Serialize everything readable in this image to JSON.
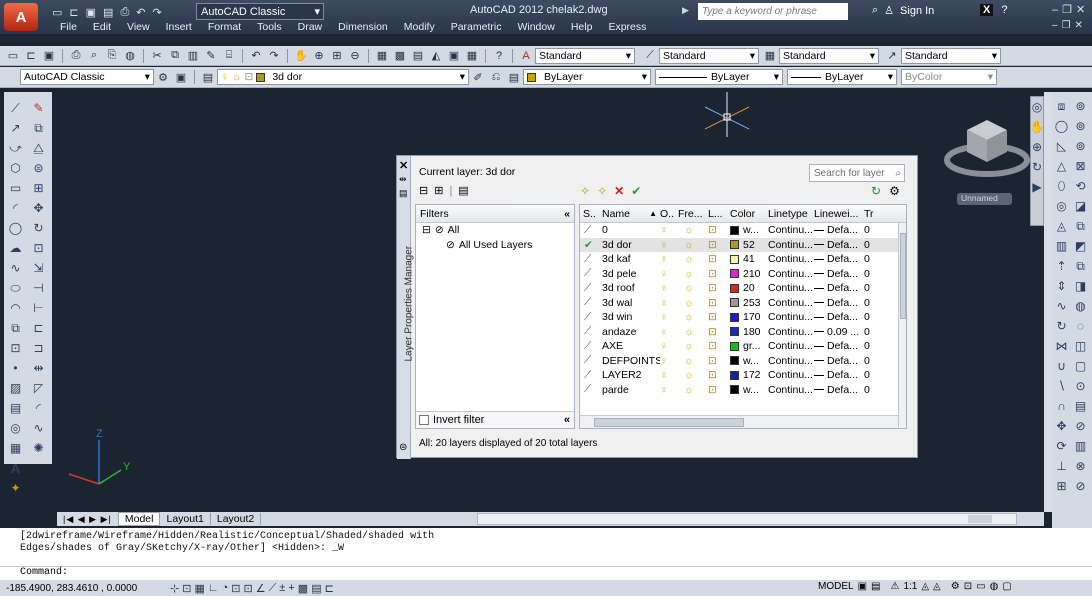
{
  "title_bar": {
    "app_menu_letter": "A",
    "workspace": "AutoCAD Classic",
    "title": "AutoCAD 2012   chelak2.dwg",
    "search_placeholder": "Type a keyword or phrase",
    "sign_in": "Sign In"
  },
  "menu": [
    "File",
    "Edit",
    "View",
    "Insert",
    "Format",
    "Tools",
    "Draw",
    "Dimension",
    "Modify",
    "Parametric",
    "Window",
    "Help",
    "Express"
  ],
  "styles_toolbar": {
    "text_style": "Standard",
    "dim_style": "Standard",
    "table_style": "Standard",
    "mleader_style": "Standard"
  },
  "layers_toolbar": {
    "workspace": "AutoCAD Classic",
    "current_layer": "3d dor",
    "color": "ByLayer",
    "linetype": "ByLayer",
    "lineweight": "ByLayer",
    "plotstyle": "ByColor"
  },
  "viewcube": {
    "named_view": "Unnamed"
  },
  "layer_palette": {
    "side_title": "Layer Properties Manager",
    "current_layer_label": "Current layer: 3d dor",
    "search_placeholder": "Search for layer",
    "filters_header": "Filters",
    "filter_tree": [
      "All",
      "All Used Layers"
    ],
    "invert_filter": "Invert filter",
    "columns": [
      "S..",
      "Name",
      "O..",
      "Fre...",
      "L...",
      "Color",
      "Linetype",
      "Linewei...",
      "Tr"
    ],
    "layers": [
      {
        "name": "0",
        "color_name": "w...",
        "color": "#000000",
        "linetype": "Continu...",
        "lineweight": "Defa...",
        "tr": "0",
        "current": false
      },
      {
        "name": "3d dor",
        "color_name": "52",
        "color": "#a89b1e",
        "linetype": "Continu...",
        "lineweight": "Defa...",
        "tr": "0",
        "current": true
      },
      {
        "name": "3d kaf",
        "color_name": "41",
        "color": "#fff2a8",
        "linetype": "Continu...",
        "lineweight": "Defa...",
        "tr": "0",
        "current": false
      },
      {
        "name": "3d pele",
        "color_name": "210",
        "color": "#e020d8",
        "linetype": "Continu...",
        "lineweight": "Defa...",
        "tr": "0",
        "current": false
      },
      {
        "name": "3d roof",
        "color_name": "20",
        "color": "#d8281e",
        "linetype": "Continu...",
        "lineweight": "Defa...",
        "tr": "0",
        "current": false
      },
      {
        "name": "3d wal",
        "color_name": "253",
        "color": "#9a9a9a",
        "linetype": "Continu...",
        "lineweight": "Defa...",
        "tr": "0",
        "current": false
      },
      {
        "name": "3d win",
        "color_name": "170",
        "color": "#1a1ad8",
        "linetype": "Continu...",
        "lineweight": "Defa...",
        "tr": "0",
        "current": false
      },
      {
        "name": "andaze",
        "color_name": "180",
        "color": "#1c2ab8",
        "linetype": "Continu...",
        "lineweight": "0.09 ...",
        "tr": "0",
        "current": false
      },
      {
        "name": "AXE",
        "color_name": "gr...",
        "color": "#12c012",
        "linetype": "Continu...",
        "lineweight": "Defa...",
        "tr": "0",
        "current": false
      },
      {
        "name": "DEFPOINTS",
        "color_name": "w...",
        "color": "#000000",
        "linetype": "Continu...",
        "lineweight": "Defa...",
        "tr": "0",
        "current": false
      },
      {
        "name": "LAYER2",
        "color_name": "172",
        "color": "#1420a8",
        "linetype": "Continu...",
        "lineweight": "Defa...",
        "tr": "0",
        "current": false
      },
      {
        "name": "parde",
        "color_name": "w...",
        "color": "#000000",
        "linetype": "Continu...",
        "lineweight": "Defa...",
        "tr": "0",
        "current": false
      }
    ],
    "status": "All: 20 layers displayed of 20 total layers"
  },
  "layout_tabs": [
    "Model",
    "Layout1",
    "Layout2"
  ],
  "command": {
    "history_line1": "[2dwireframe/Wireframe/Hidden/Realistic/Conceptual/Shaded/shaded with",
    "history_line2": "Edges/shades of Gray/SKetchy/X-ray/Other] <Hidden>: _W",
    "prompt": "Command:"
  },
  "status_bar": {
    "coords": "-185.4900, 283.4610 , 0.0000",
    "mode": "MODEL",
    "scale": "1:1"
  }
}
